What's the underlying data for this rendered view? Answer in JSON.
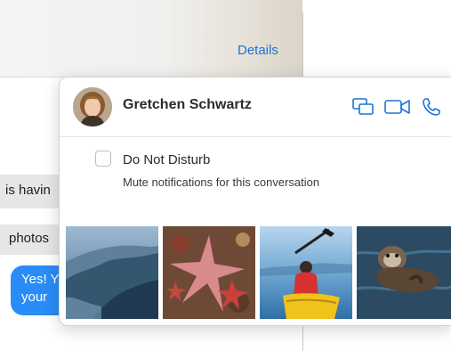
{
  "header": {
    "details_label": "Details"
  },
  "messages": [
    {
      "text": "is havin",
      "kind": "received"
    },
    {
      "text": "photos",
      "kind": "received"
    },
    {
      "line1": "Yes! Y",
      "line2": "your",
      "kind": "sent"
    }
  ],
  "popover": {
    "contact_name": "Gretchen Schwartz",
    "actions": [
      {
        "name": "screen-share",
        "icon": "screen-share-icon"
      },
      {
        "name": "facetime-video",
        "icon": "video-camera-icon"
      },
      {
        "name": "call",
        "icon": "phone-icon"
      }
    ],
    "do_not_disturb": {
      "label": "Do Not Disturb",
      "description": "Mute notifications for this conversation",
      "checked": false
    },
    "photos": [
      {
        "subject": "coastal cliffs"
      },
      {
        "subject": "starfish"
      },
      {
        "subject": "kayaker"
      },
      {
        "subject": "sea otter"
      }
    ]
  },
  "colors": {
    "accent": "#1a73d9",
    "sent_bubble": "#2a8cf6",
    "received_bubble": "#e6e6e8"
  }
}
